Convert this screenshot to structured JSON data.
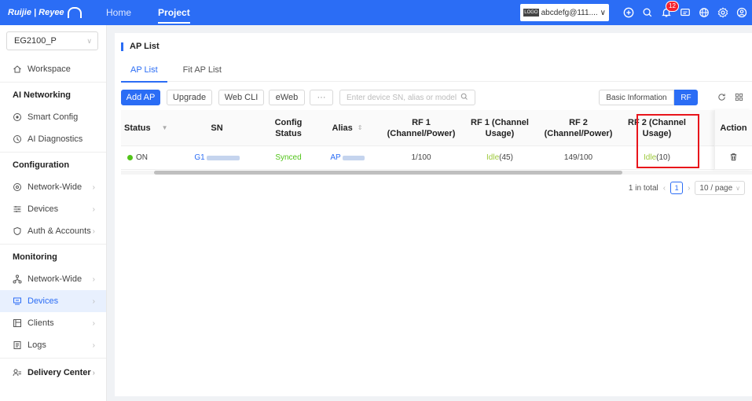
{
  "brand": {
    "logo_text": "Ruijie | Reyee"
  },
  "nav": {
    "items": [
      {
        "label": "Home"
      },
      {
        "label": "Project"
      }
    ]
  },
  "topbar": {
    "account_tag": "LOGO",
    "account_label": "abcdefg@111....",
    "notification_count": "12"
  },
  "sidebar": {
    "project": "EG2100_P",
    "workspace": "Workspace",
    "sections": [
      {
        "heading": "AI Networking",
        "items": [
          {
            "label": "Smart Config"
          },
          {
            "label": "AI Diagnostics"
          }
        ]
      },
      {
        "heading": "Configuration",
        "items": [
          {
            "label": "Network-Wide"
          },
          {
            "label": "Devices"
          },
          {
            "label": "Auth & Accounts"
          }
        ]
      },
      {
        "heading": "Monitoring",
        "items": [
          {
            "label": "Network-Wide"
          },
          {
            "label": "Devices"
          },
          {
            "label": "Clients"
          },
          {
            "label": "Logs"
          }
        ]
      }
    ],
    "delivery_center": "Delivery Center"
  },
  "page": {
    "title": "AP List",
    "tabs": [
      {
        "label": "AP List"
      },
      {
        "label": "Fit AP List"
      }
    ]
  },
  "toolbar": {
    "add_ap": "Add AP",
    "upgrade": "Upgrade",
    "web_cli": "Web CLI",
    "eweb": "eWeb",
    "more": "···",
    "search_placeholder": "Enter device SN, alias or model",
    "view_basic": "Basic Information",
    "view_rf": "RF"
  },
  "table": {
    "columns": {
      "status": "Status",
      "sn": "SN",
      "config_status": "Config Status",
      "alias": "Alias",
      "rf1_channel_power": "RF 1 (Channel/Power)",
      "rf1_usage": "RF 1 (Channel Usage)",
      "rf2_channel_power": "RF 2 (Channel/Power)",
      "rf2_usage": "RF 2 (Channel Usage)",
      "action": "Action"
    },
    "rows": [
      {
        "status": "ON",
        "sn": "G1",
        "config_status": "Synced",
        "alias": "AP",
        "rf1_channel_power": "1/100",
        "rf1_usage_state": "Idle",
        "rf1_usage_value": "(45)",
        "rf2_channel_power": "149/100",
        "rf2_usage_state": "Idle",
        "rf2_usage_value": "(10)"
      }
    ]
  },
  "pagination": {
    "total": "1 in total",
    "current": "1",
    "page_size": "10 / page"
  },
  "colors": {
    "primary": "#2b6df5",
    "online": "#52c41a",
    "idle": "#9dc93a",
    "highlight": "#e8141b"
  }
}
